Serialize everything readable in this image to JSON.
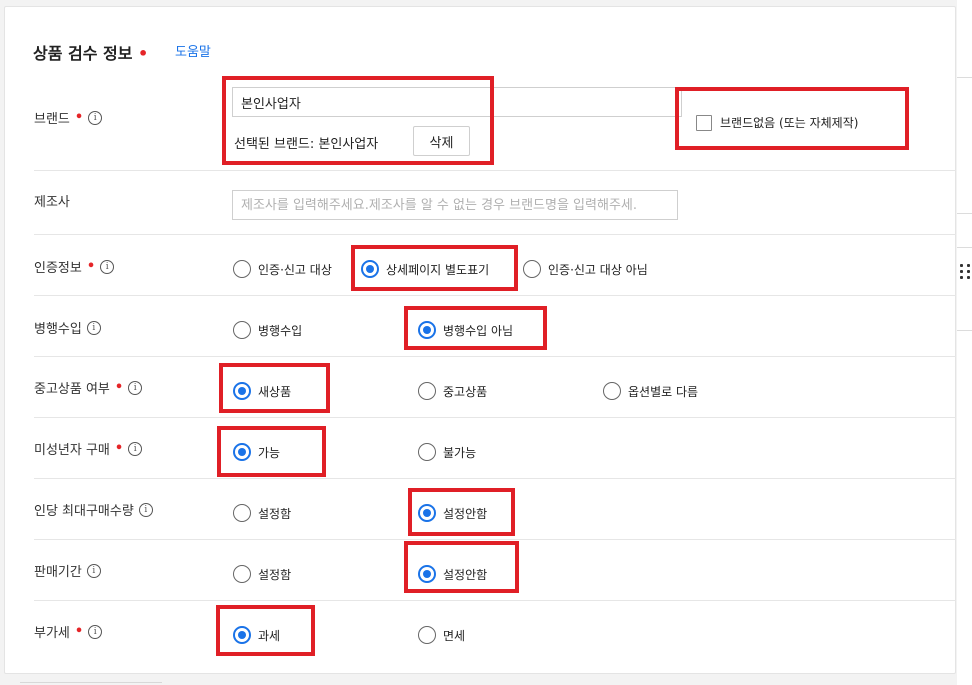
{
  "section": {
    "title": "상품 검수 정보",
    "required_mark": "•",
    "help_link": "도움말"
  },
  "icons": {
    "info": "info-circle-icon",
    "handle": "drag-handle-icon"
  },
  "colors": {
    "accent": "#1a73e8",
    "required": "#e52528",
    "highlight_box": "#e01f26"
  },
  "brand": {
    "label": "브랜드",
    "input_value": "본인사업자",
    "selected_text": "선택된 브랜드: 본인사업자",
    "delete_button": "삭제",
    "no_brand_checkbox": "브랜드없음 (또는 자체제작)",
    "no_brand_checked": false
  },
  "manufacturer": {
    "label": "제조사",
    "placeholder": "제조사를 입력해주세요.제조사를 알 수 없는 경우 브랜드명을 입력해주세."
  },
  "certification": {
    "label": "인증정보",
    "options": [
      "인증·신고 대상",
      "상세페이지 별도표기",
      "인증·신고 대상 아님"
    ],
    "selected": "상세페이지 별도표기"
  },
  "parallel_import": {
    "label": "병행수입",
    "options": [
      "병행수입",
      "병행수입 아님"
    ],
    "selected": "병행수입 아님"
  },
  "used_status": {
    "label": "중고상품 여부",
    "options": [
      "새상품",
      "중고상품",
      "옵션별로 다름"
    ],
    "selected": "새상품"
  },
  "minor_purchase": {
    "label": "미성년자 구매",
    "options": [
      "가능",
      "불가능"
    ],
    "selected": "가능"
  },
  "max_per_person": {
    "label": "인당 최대구매수량",
    "options": [
      "설정함",
      "설정안함"
    ],
    "selected": "설정안함"
  },
  "sale_period": {
    "label": "판매기간",
    "options": [
      "설정함",
      "설정안함"
    ],
    "selected": "설정안함"
  },
  "vat": {
    "label": "부가세",
    "options": [
      "과세",
      "면세"
    ],
    "selected": "과세"
  }
}
